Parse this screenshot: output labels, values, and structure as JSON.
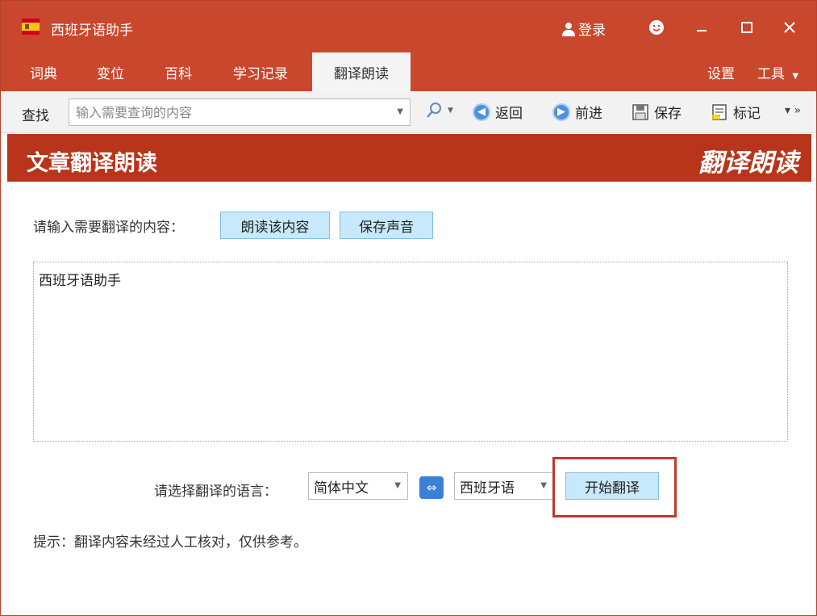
{
  "app": {
    "title": "西班牙语助手"
  },
  "titlebar": {
    "login": "登录"
  },
  "menu": {
    "items": [
      "词典",
      "变位",
      "百科",
      "学习记录"
    ],
    "active": "翻译朗读",
    "right": {
      "settings": "设置",
      "tools": "工具"
    }
  },
  "toolbar": {
    "find": "查找",
    "search_placeholder": "输入需要查询的内容",
    "back": "返回",
    "forward": "前进",
    "save": "保存",
    "mark": "标记"
  },
  "banner": {
    "title": "文章翻译朗读",
    "brand": "翻译朗读"
  },
  "content": {
    "prompt": "请输入需要翻译的内容：",
    "read_button": "朗读该内容",
    "save_sound_button": "保存声音",
    "input_text": "西班牙语助手",
    "lang_label": "请选择翻译的语言：",
    "source_lang": "简体中文",
    "target_lang": "西班牙语",
    "start_button": "开始翻译",
    "tip": "提示：翻译内容未经过人工核对，仅供参考。"
  },
  "colors": {
    "title_bg": "#c9482d",
    "banner_bg": "#b8341a",
    "button_bg": "#c8e8fb",
    "highlight": "#c0392b"
  },
  "icons": [
    "app-flag-icon",
    "user-icon",
    "smile-icon",
    "minimize-icon",
    "maximize-icon",
    "close-icon",
    "search-icon",
    "back-icon",
    "forward-icon",
    "save-icon",
    "mark-icon",
    "swap-icon"
  ]
}
